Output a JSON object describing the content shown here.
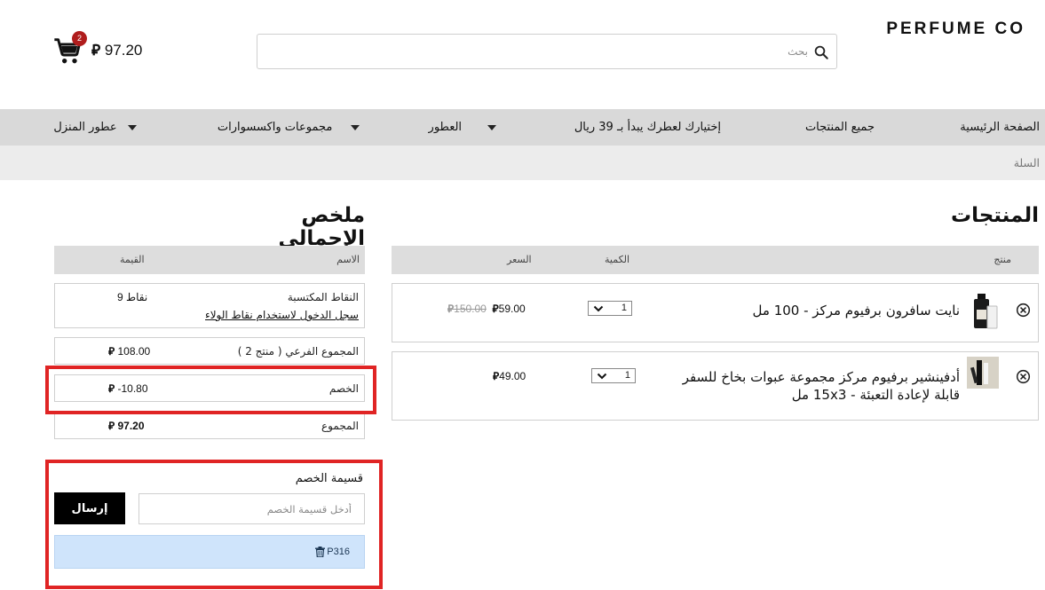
{
  "header": {
    "brand": "PERFUME CO",
    "search_placeholder": "بحث",
    "cart_count": "2",
    "cart_total": "97.20",
    "currency_symbol": "⃁"
  },
  "nav": {
    "items": [
      {
        "label": "الصفحة الرئيسية",
        "has_dropdown": false
      },
      {
        "label": "جميع المنتجات",
        "has_dropdown": false
      },
      {
        "label": "إختيارك لعطرك يبدأ بـ 39 ريال",
        "has_dropdown": false
      },
      {
        "label": "العطور",
        "has_dropdown": true
      },
      {
        "label": "مجموعات واكسسوارات",
        "has_dropdown": true
      },
      {
        "label": "عطور المنزل",
        "has_dropdown": true
      }
    ]
  },
  "breadcrumb": {
    "current": "السلة"
  },
  "products": {
    "title": "المنتجات",
    "columns": {
      "product": "منتج",
      "quantity": "الكمية",
      "price": "السعر"
    },
    "items": [
      {
        "name": "نايت سافرون برفيوم مركز - 100 مل",
        "quantity": "1",
        "price": "59.00",
        "old_price": "150.00"
      },
      {
        "name": "أدفينشير برفيوم مركز مجموعة عبوات بخاخ للسفر قابلة لإعادة التعبئة - 15x3 مل",
        "quantity": "1",
        "price": "49.00",
        "old_price": ""
      }
    ]
  },
  "summary": {
    "title": "ملخص الإجمالي",
    "columns": {
      "name": "الاسم",
      "value": "القيمة"
    },
    "points_label": "النقاط المكتسبة",
    "points_value": "9 نقاط",
    "points_link": "سجل الدخول لاستخدام نقاط الولاء",
    "subtotal_label": "المجموع الفرعي ( منتج 2 )",
    "subtotal_value": "108.00",
    "discount_label": "الخصم",
    "discount_value": "-10.80",
    "total_label": "المجموع",
    "total_value": "97.20"
  },
  "coupon": {
    "title": "قسيمة الخصم",
    "placeholder": "أدخل قسيمة الخصم",
    "submit_label": "إرسال",
    "applied_code": "P316"
  },
  "colors": {
    "nav_bg": "#d9d9d9",
    "highlight_border": "#e02424",
    "badge": "#b01d1d",
    "applied_bg": "#cfe4fb"
  }
}
